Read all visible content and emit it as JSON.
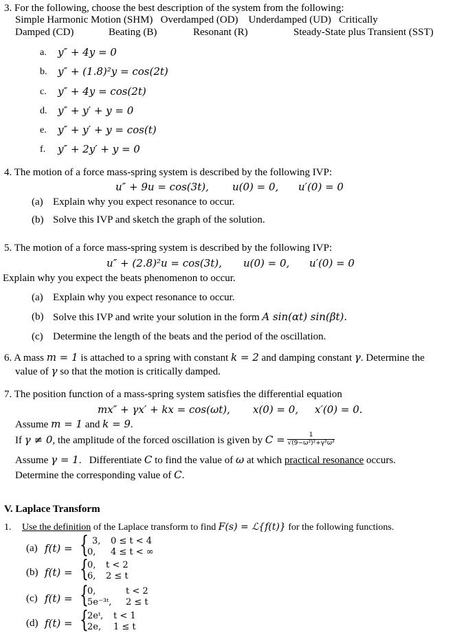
{
  "q3": {
    "header": "3. For the following, choose the best description of the system from the following:",
    "line2": "Simple Harmonic Motion (SHM)   Overdamped (OD)    Underdamped (UD)   Critically",
    "line3_parts": [
      "Damped (CD)",
      "Beating (B)",
      "Resonant (R)",
      "Steady-State plus Transient (SST)"
    ],
    "items": [
      {
        "label": "a.",
        "eq": "y″ + 4y = 0"
      },
      {
        "label": "b.",
        "eq": "y″ + (1.8)²y = cos(2t)"
      },
      {
        "label": "c.",
        "eq": "y″ + 4y = cos(2t)"
      },
      {
        "label": "d.",
        "eq": "y″ + y′ + y = 0"
      },
      {
        "label": "e.",
        "eq": "y″ + y′ + y = cos(t)"
      },
      {
        "label": "f.",
        "eq": "y″ + 2y′ + y = 0"
      }
    ]
  },
  "q4": {
    "header": "4. The motion of a force mass-spring system is described by the following IVP:",
    "eq": "u″ + 9u = cos(3t),",
    "ic1": "u(0) = 0,",
    "ic2": "u′(0) = 0",
    "parts": [
      {
        "label": "(a)",
        "text": "Explain why you expect resonance to occur."
      },
      {
        "label": "(b)",
        "text": "Solve this IVP and sketch the graph of the solution."
      }
    ]
  },
  "q5": {
    "header": "5. The motion of a force mass-spring system is described by the following IVP:",
    "eq": "u″ + (2.8)²u = cos(3t),",
    "ic1": "u(0) = 0,",
    "ic2": "u′(0) = 0",
    "explain": "Explain why you expect the beats phenomenon to occur.",
    "parts": [
      {
        "label": "(a)",
        "text": "Explain why you expect resonance to occur."
      },
      {
        "label": "(b)",
        "text": "Solve this IVP and write your solution in the form ",
        "math": "A sin(αt) sin(βt)."
      },
      {
        "label": "(c)",
        "text": "Determine the length of the beats and the period of the oscillation."
      }
    ]
  },
  "q6": {
    "line1_a": "6. A mass ",
    "m_eq": "m = 1",
    "line1_b": " is attached to a spring with constant ",
    "k_eq": "k = 2",
    "line1_c": " and damping constant ",
    "gamma": "γ",
    "line1_d": ". Determine the",
    "line2_a": "value of ",
    "line2_b": " so that the motion is critically damped."
  },
  "q7": {
    "header": "7. The position function of a mass-spring system satisfies the differential equation",
    "eq": "mx″ + γx′ + kx = cos(ωt),",
    "ic1": "x(0) = 0,",
    "ic2": "x′(0) = 0.",
    "assume1_a": "Assume ",
    "assume1_m": "m = 1",
    "assume1_b": " and ",
    "assume1_k": "k = 9",
    "assume1_c": ".",
    "if_a": "If ",
    "if_gamma": "γ ≠ 0",
    "if_b": ", the amplitude of the forced oscillation is given by ",
    "C_lhs": "C =",
    "C_num": "1",
    "C_den": "√(9−ω²)²+γ²ω²",
    "assume2_a": "Assume ",
    "assume2_gamma": "γ = 1",
    "assume2_b": ".   Differentiate ",
    "assume2_C": "C",
    "assume2_c": " to find the value of ",
    "assume2_omega": "ω",
    "assume2_d": " at which ",
    "assume2_link": "practical resonance",
    "assume2_e": " occurs.",
    "determine_a": "Determine the corresponding value of ",
    "determine_C": "C",
    "determine_b": "."
  },
  "section5": {
    "title": "V.  Laplace Transform",
    "q1_num": "1.",
    "q1_link": "Use the definition",
    "q1_text": " of the Laplace transform to find ",
    "q1_math": "F(s) = ℒ{f(t)}",
    "q1_tail": " for the following functions.",
    "functions": [
      {
        "label": "(a)",
        "lhs": "f(t) =",
        "cases": [
          [
            "3,",
            "0 ≤ t < 4"
          ],
          [
            "0,",
            "4 ≤ t < ∞"
          ]
        ]
      },
      {
        "label": "(b)",
        "lhs": "f(t) =",
        "cases": [
          [
            "0,",
            "t < 2"
          ],
          [
            "6,",
            "2 ≤ t"
          ]
        ]
      },
      {
        "label": "(c)",
        "lhs": "f(t) =",
        "cases": [
          [
            "0,",
            "t < 2"
          ],
          [
            "5e⁻³ᵗ,",
            "2 ≤ t"
          ]
        ]
      },
      {
        "label": "(d)",
        "lhs": "f(t) =",
        "cases": [
          [
            "2eᵗ,",
            "t < 1"
          ],
          [
            "2e,",
            "1 ≤ t"
          ]
        ]
      }
    ]
  }
}
